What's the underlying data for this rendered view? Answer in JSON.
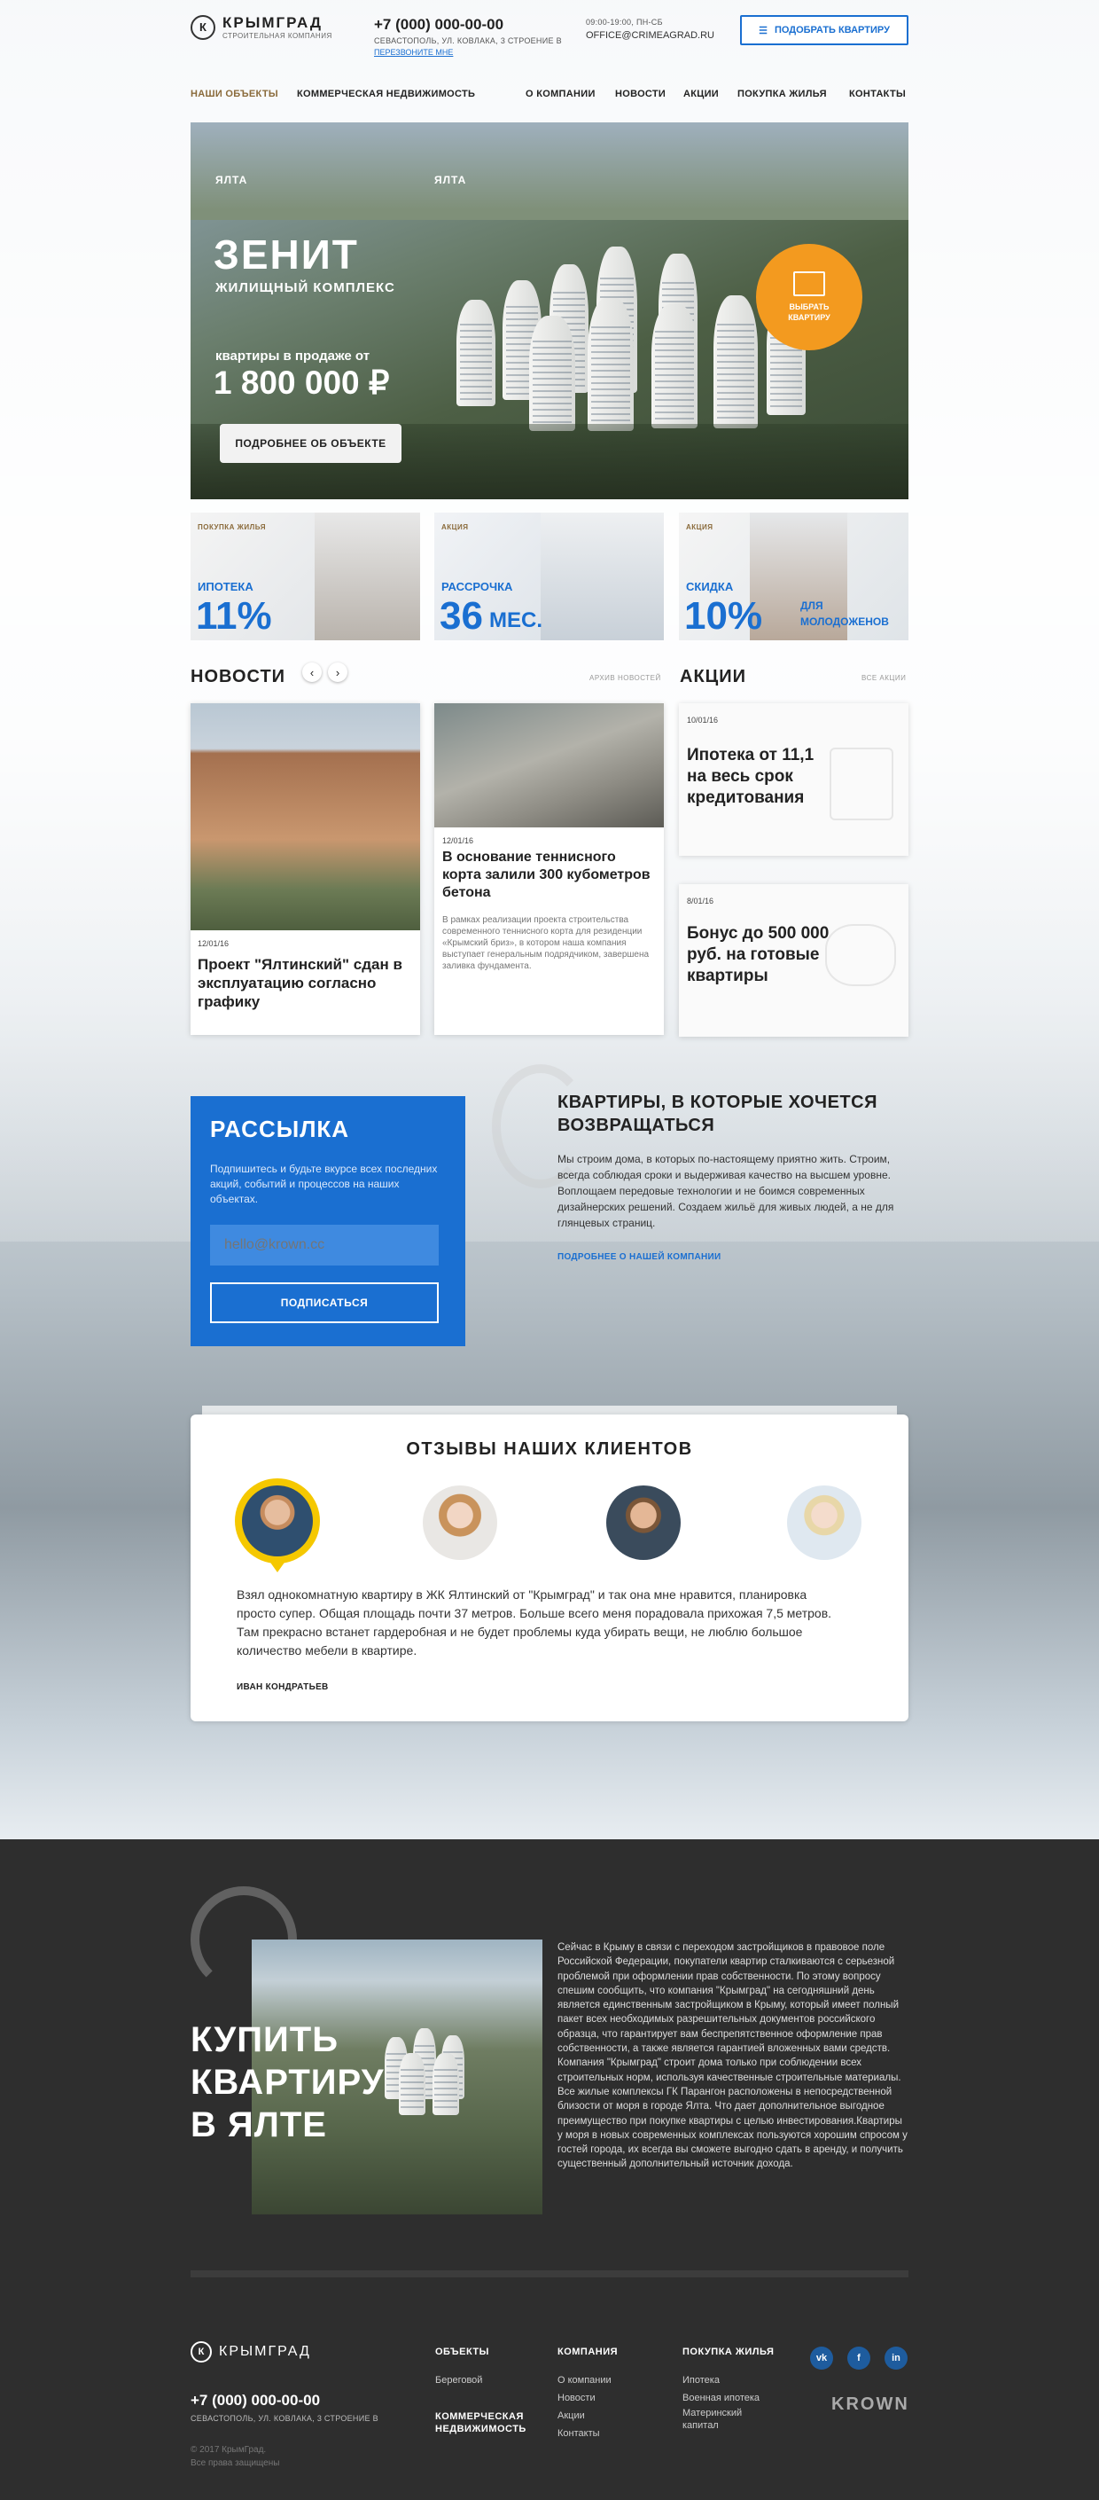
{
  "header": {
    "logo_letter": "К",
    "logo_title": "КРЫМГРАД",
    "logo_sub": "СТРОИТЕЛЬНАЯ КОМПАНИЯ",
    "phone": "+7 (000) 000-00-00",
    "address": "СЕВАСТОПОЛЬ, УЛ. КОВЛАКА, 3 СТРОЕНИЕ В",
    "callback": "ПЕРЕЗВОНИТЕ МНЕ",
    "hours": "09:00-19:00, ПН-СБ",
    "email": "OFFICE@CRIMEAGRAD.RU",
    "pick_button": "ПОДОБРАТЬ КВАРТИРУ"
  },
  "nav": {
    "items": [
      "НАШИ ОБЪЕКТЫ",
      "КОММЕРЧЕСКАЯ НЕДВИЖИМОСТЬ",
      "О КОМПАНИИ",
      "НОВОСТИ",
      "АКЦИИ",
      "ПОКУПКА ЖИЛЬЯ",
      "КОНТАКТЫ"
    ],
    "active_color": "#8a6a3a"
  },
  "hero": {
    "city1": "ЯЛТА",
    "city2": "ЯЛТА",
    "title": "ЗЕНИТ",
    "subtitle": "ЖИЛИЩНЫЙ КОМПЛЕКС",
    "price_label": "квартиры в продаже от",
    "price": "1 800 000 ₽",
    "details_button": "ПОДРОБНЕЕ ОБ ОБЪЕКТЕ",
    "choose_button": "ВЫБРАТЬ КВАРТИРУ",
    "accent": "#f39a1f"
  },
  "promos": [
    {
      "tag": "ПОКУПКА ЖИЛЬЯ",
      "label": "ИПОТЕКА",
      "value": "11%",
      "extra": ""
    },
    {
      "tag": "АКЦИЯ",
      "label": "РАССРОЧКА",
      "value": "36",
      "extra": "МЕС."
    },
    {
      "tag": "АКЦИЯ",
      "label": "СКИДКА",
      "value": "10%",
      "extra": "ДЛЯ МОЛОДОЖЕНОВ"
    }
  ],
  "news": {
    "title": "НОВОСТИ",
    "archive": "АРХИВ НОВОСТЕЙ",
    "items": [
      {
        "date": "12/01/16",
        "title": "Проект \"Ялтинский\" сдан в эксплуатацию согласно графику",
        "text": ""
      },
      {
        "date": "12/01/16",
        "title": "В основание теннисного корта залили 300 кубометров бетона",
        "text": "В рамках реализации проекта строительства современного теннисного корта для резиденции «Крымский бриз», в котором наша компания выступает генеральным подрядчиком, завершена заливка фундамента."
      }
    ]
  },
  "sales": {
    "title": "АКЦИИ",
    "all": "ВСЕ АКЦИИ",
    "items": [
      {
        "date": "10/01/16",
        "title": "Ипотека от 11,1 на весь срок кредитования"
      },
      {
        "date": "8/01/16",
        "title": "Бонус до 500 000 руб. на готовые квартиры"
      }
    ]
  },
  "newsletter": {
    "title": "РАССЫЛКА",
    "text": "Подпишитесь и будьте вкурсе всех последних акций, событий и процессов на наших объектах.",
    "placeholder": "hello@krown.cc",
    "button": "ПОДПИСАТЬСЯ",
    "color": "#1a6fd1"
  },
  "about": {
    "title": "КВАРТИРЫ, В КОТОРЫЕ ХОЧЕТСЯ ВОЗВРАЩАТЬСЯ",
    "text": "Мы строим дома, в которых по-настоящему приятно жить. Строим, всегда соблюдая сроки и выдерживая качество на высшем уровне. Воплощаем передовые технологии и не боимся современных дизайнерских решений. Создаем жильё для живых людей, а не для глянцевых страниц.",
    "link": "ПОДРОБНЕЕ О НАШЕЙ КОМПАНИИ"
  },
  "reviews": {
    "title": "ОТЗЫВЫ НАШИХ КЛИЕНТОВ",
    "text": "Взял однокомнатную квартиру в ЖК Ялтинский от \"Крымград\" и так она мне нравится, планировка просто супер. Общая площадь почти 37 метров. Больше всего меня порадовала прихожая 7,5 метров. Там прекрасно встанет гардеробная и не будет проблемы куда убирать вещи, не люблю большое количество мебели в квартире.",
    "author": "ИВАН КОНДРАТЬЕВ"
  },
  "buy": {
    "title_lines": [
      "КУПИТЬ",
      "КВАРТИРУ",
      "В ЯЛТЕ"
    ],
    "text": "Сейчас в Крыму в связи с переходом застройщиков в правовое поле Российской Федерации, покупатели квартир сталкиваются с серьезной проблемой при оформлении прав собственности. По этому вопросу спешим сообщить, что компания \"Крымград\" на сегодняшний день является единственным застройщиком в Крыму, который имеет полный пакет всех необходимых разрешительных документов российского образца, что гарантирует вам беспрепятственное оформление прав собственности, а также является гарантией вложенных вами средств. Компания \"Крымград\" строит дома только при соблюдении всех строительных норм, используя качественные строительные материалы. Все жилые комплексы ГК Парангон расположены в непосредственной близости от моря в городе Ялта. Что дает дополнительное выгодное преимущество при покупке квартиры с целью инвестирования.Квартиры у моря в новых современных комплексах пользуются хорошим спросом у гостей города, их всегда вы сможете выгодно сдать в аренду, и получить существенный дополнительный источник дохода."
  },
  "footer": {
    "logo_title": "КРЫМГРАД",
    "phone": "+7 (000) 000-00-00",
    "address": "СЕВАСТОПОЛЬ, УЛ. КОВЛАКА, 3 СТРОЕНИЕ В",
    "copyright": "© 2017 КрымГрад.",
    "rights": "Все права защищены",
    "col1_title": "ОБЪЕКТЫ",
    "col1_items": [
      "Береговой"
    ],
    "col1_extra": "КОММЕРЧЕСКАЯ НЕДВИЖИМОСТЬ",
    "col2_title": "КОМПАНИЯ",
    "col2_items": [
      "О компании",
      "Новости",
      "Акции",
      "Контакты"
    ],
    "col3_title": "ПОКУПКА ЖИЛЬЯ",
    "col3_items": [
      "Ипотека",
      "Военная ипотека",
      "Материнский капитал"
    ],
    "social": [
      "vk",
      "f",
      "in"
    ],
    "brand": "KROWN",
    "bg": "#2e2e2e"
  }
}
